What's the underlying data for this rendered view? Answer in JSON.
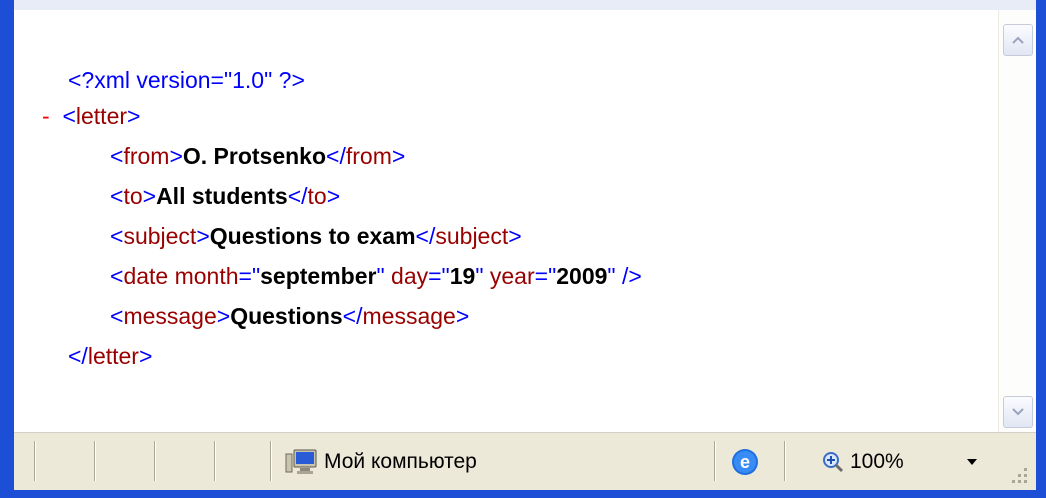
{
  "xml": {
    "declaration": "<?xml version=\"1.0\" ?>",
    "collapse_marker": "-",
    "lines": [
      {
        "open": "from",
        "value": "O. Protsenko",
        "close": "from"
      },
      {
        "open": "to",
        "value": "All students",
        "close": "to"
      },
      {
        "open": "subject",
        "value": "Questions to exam",
        "close": "subject"
      }
    ],
    "root_tag": "letter",
    "date": {
      "tag": "date",
      "attrs": [
        {
          "name": "month",
          "value": "september"
        },
        {
          "name": "day",
          "value": "19"
        },
        {
          "name": "year",
          "value": "2009"
        }
      ]
    },
    "message": {
      "open": "message",
      "value": "Questions",
      "close": "message"
    }
  },
  "statusbar": {
    "zone_label": "Мой компьютер",
    "zone_icon": "my-computer-icon",
    "ie_icon": "ie-icon",
    "zoom_icon": "zoom-icon",
    "zoom": "100%"
  },
  "colors": {
    "markup_blue": "#0000ff",
    "tag_red": "#990000",
    "frame_blue": "#1c4fd6",
    "status_bg": "#ece9d8"
  }
}
